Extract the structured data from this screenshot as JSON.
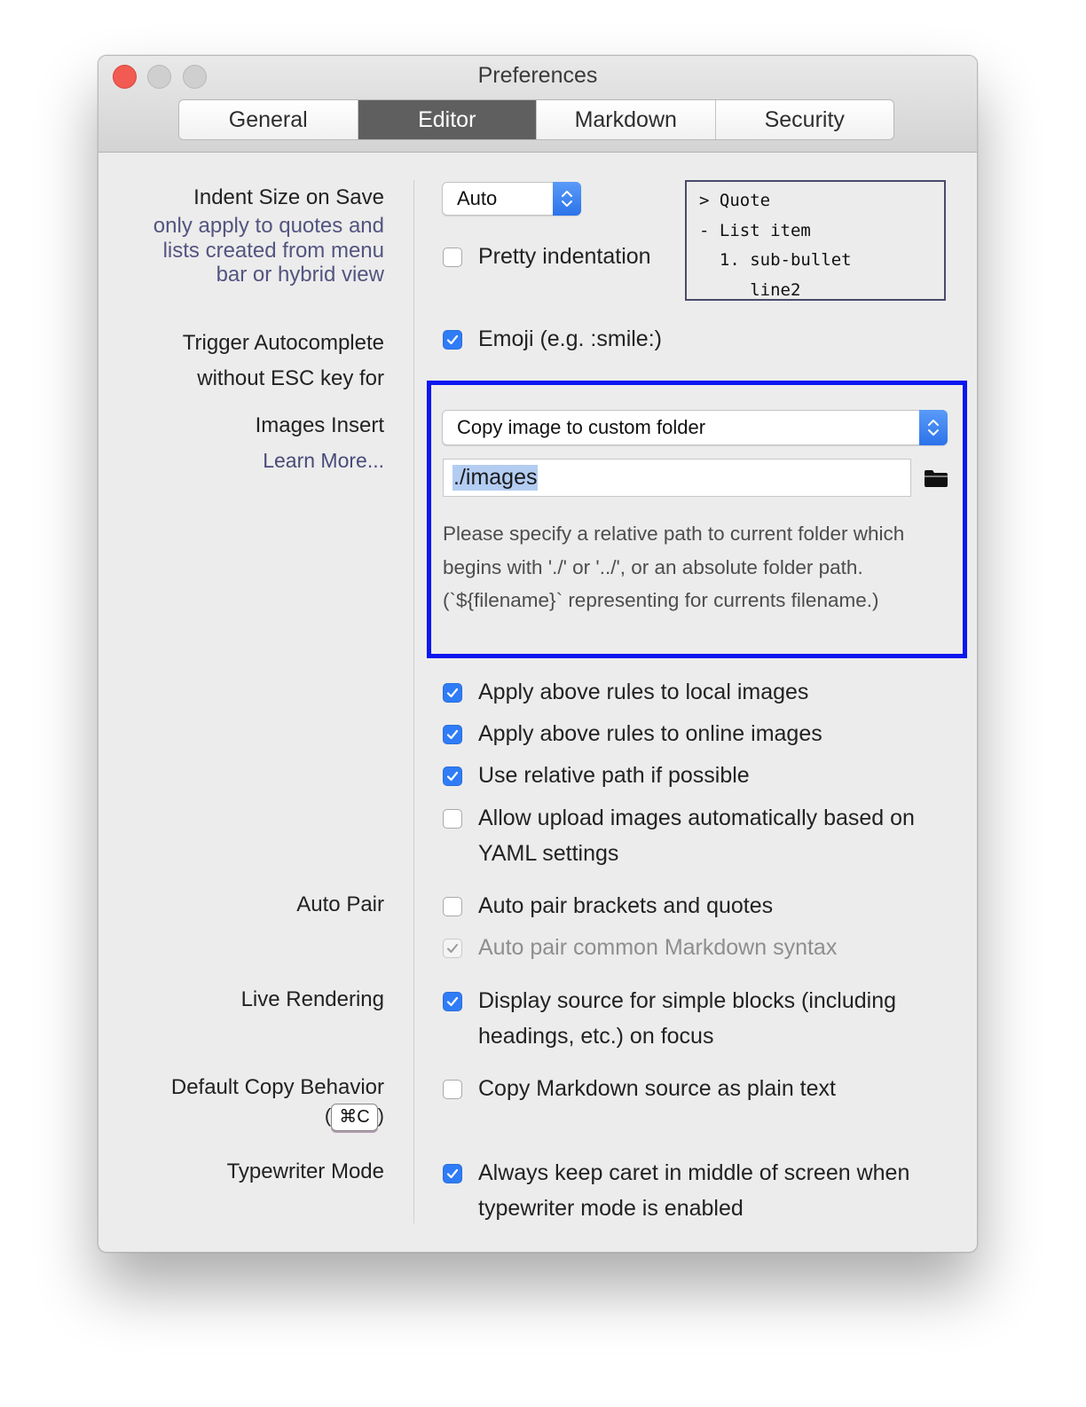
{
  "window": {
    "title": "Preferences"
  },
  "tabs": [
    "General",
    "Editor",
    "Markdown",
    "Security"
  ],
  "indent": {
    "label": "Indent Size on Save",
    "note": [
      "only apply to quotes and",
      "lists created from menu",
      "bar or hybrid view"
    ],
    "select_value": "Auto",
    "pretty_label": "Pretty indentation",
    "pretty_checked": false,
    "preview_lines": [
      "> Quote",
      "- List item",
      "  1. sub-bullet",
      "     line2"
    ]
  },
  "autocomplete": {
    "label_lines": [
      "Trigger Autocomplete",
      "without ESC key for"
    ],
    "emoji_label": "Emoji (e.g. :smile:)",
    "emoji_checked": true
  },
  "images": {
    "label": "Images Insert",
    "learn_more": "Learn More...",
    "select_value": "Copy image to custom folder",
    "path_value": "./images",
    "help_text": "Please specify a relative path to current folder which begins with './' or '../', or an absolute folder path. (`${filename}` representing for currents filename.)",
    "options": [
      {
        "label": "Apply above rules to local images",
        "checked": true
      },
      {
        "label": "Apply above rules to online images",
        "checked": true
      },
      {
        "label": "Use relative path if possible",
        "checked": true
      },
      {
        "label": "Allow upload images automatically based on YAML settings",
        "checked": false
      }
    ]
  },
  "auto_pair": {
    "label": "Auto Pair",
    "brackets_label": "Auto pair brackets and quotes",
    "brackets_checked": false,
    "markdown_label": "Auto pair common Markdown syntax",
    "markdown_checked": true,
    "markdown_disabled": true
  },
  "live_rendering": {
    "label": "Live Rendering",
    "option_label": "Display source for simple blocks (including headings, etc.) on focus",
    "checked": true
  },
  "copy_behavior": {
    "label": "Default Copy Behavior",
    "shortcut": "⌘C",
    "paren_open": "(",
    "paren_close": ")",
    "option_label": "Copy Markdown source as plain text",
    "checked": false
  },
  "typewriter": {
    "label": "Typewriter Mode",
    "option_label": "Always keep caret in middle of screen when typewriter mode is enabled",
    "checked": true
  },
  "colors": {
    "accent_blue": "#2f7cf6",
    "highlight_border": "#0a17f0",
    "close_button": "#f25b52",
    "active_tab": "#5f5f5f"
  }
}
